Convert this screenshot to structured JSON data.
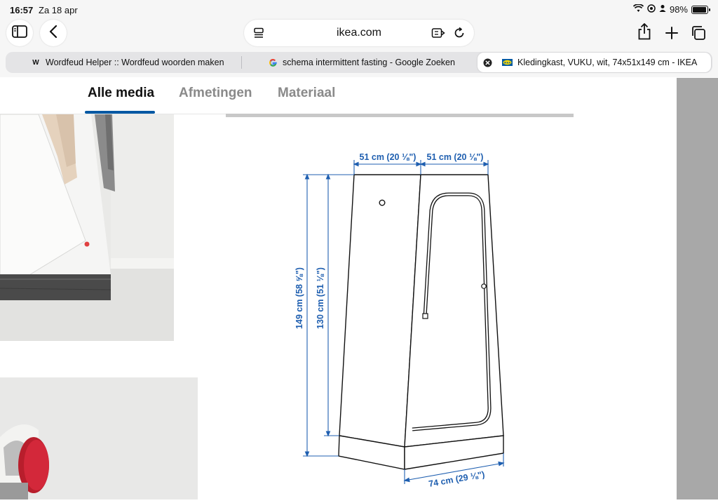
{
  "status": {
    "time": "16:57",
    "date": "Za 18 apr",
    "battery": "98%"
  },
  "browser": {
    "url": "ikea.com",
    "icons": [
      "sidebar-icon",
      "back-icon",
      "reader-icon",
      "translate-icon",
      "reload-icon",
      "share-icon",
      "plus-icon",
      "tabs-icon"
    ],
    "tabs": [
      {
        "favicon": "W",
        "title": "Wordfeud Helper :: Wordfeud woorden maken"
      },
      {
        "favicon": "G",
        "title": "schema intermittent fasting - Google Zoeken"
      },
      {
        "favicon": "IKEA",
        "title": "Kledingkast, VUKU, wit, 74x51x149 cm - IKEA"
      }
    ]
  },
  "media": {
    "tabs": [
      "Alle media",
      "Afmetingen",
      "Materiaal"
    ],
    "active_tab": "Alle media"
  },
  "diagram": {
    "depth_label": "51 cm (20 ⅛\")",
    "width_side_label": "51 cm (20 ⅛\")",
    "total_height_label": "149 cm (58 ⅝\")",
    "inner_height_label": "130 cm (51 ⅛\")",
    "width_label": "74 cm (29 ⅛\")"
  },
  "colors": {
    "accent": "#0058a3",
    "dimension": "#1f5fb0"
  }
}
